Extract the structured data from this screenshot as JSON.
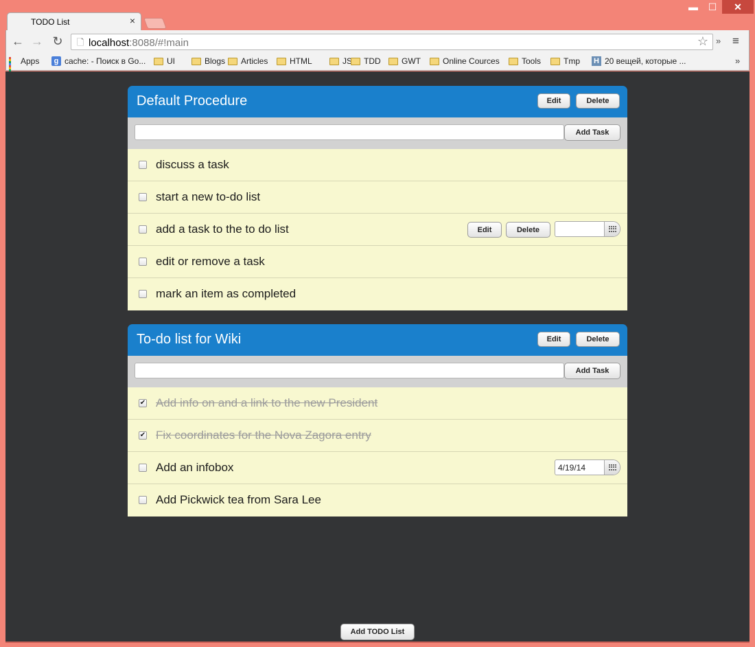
{
  "browser": {
    "tab_title": "TODO List",
    "tab_close": "×",
    "url_host": "localhost",
    "url_rest": ":8088/#!main",
    "window_controls": {
      "minimize": "▬",
      "maximize": "☐",
      "close": "✕"
    },
    "overflow_glyph": "»",
    "menu_glyph": "≡",
    "bookmarks": [
      {
        "label": "Apps",
        "icon": "apps-icon"
      },
      {
        "label": "cache: - Поиск в Go...",
        "icon": "google-icon"
      },
      {
        "label": "UI",
        "icon": "folder-icon"
      },
      {
        "label": "Blogs",
        "icon": "folder-icon"
      },
      {
        "label": "Articles",
        "icon": "folder-icon"
      },
      {
        "label": "HTML",
        "icon": "folder-icon"
      },
      {
        "label": "JS",
        "icon": "folder-icon"
      },
      {
        "label": "TDD",
        "icon": "folder-icon"
      },
      {
        "label": "GWT",
        "icon": "folder-icon"
      },
      {
        "label": "Online Cources",
        "icon": "folder-icon"
      },
      {
        "label": "Tools",
        "icon": "folder-icon"
      },
      {
        "label": "Tmp",
        "icon": "folder-icon"
      },
      {
        "label": "20 вещей, которые ...",
        "icon": "h-icon"
      }
    ]
  },
  "lists": [
    {
      "title": "Default Procedure",
      "edit_label": "Edit",
      "delete_label": "Delete",
      "add_task_label": "Add Task",
      "task_input_value": "",
      "tasks": [
        {
          "text": "discuss a task",
          "done": false
        },
        {
          "text": "start a new to-do list",
          "done": false
        },
        {
          "text": "add a task to the to do list",
          "done": false,
          "hovered": true,
          "edit_label": "Edit",
          "delete_label": "Delete",
          "date": ""
        },
        {
          "text": "edit or remove a task",
          "done": false
        },
        {
          "text": "mark an item as completed",
          "done": false
        }
      ]
    },
    {
      "title": "To-do list for Wiki",
      "edit_label": "Edit",
      "delete_label": "Delete",
      "add_task_label": "Add Task",
      "task_input_value": "",
      "tasks": [
        {
          "text": "Add info on and a link to the new President",
          "done": true
        },
        {
          "text": "Fix coordinates for the Nova Zagora entry",
          "done": true
        },
        {
          "text": "Add an infobox",
          "done": false,
          "date": "4/19/14"
        },
        {
          "text": "Add Pickwick tea from Sara Lee",
          "done": false
        }
      ]
    }
  ],
  "add_list_label": "Add TODO List",
  "colors": {
    "header_blue": "#1a80cc",
    "task_bg": "#f8f8d0",
    "page_bg": "#333436",
    "frame": "#f38477"
  }
}
